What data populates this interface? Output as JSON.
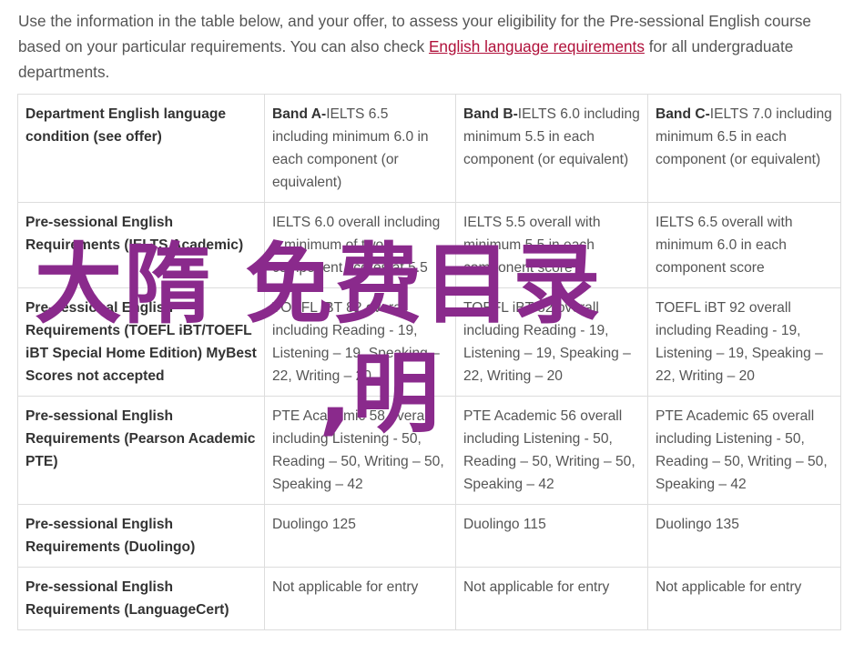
{
  "intro": {
    "text_before_link": "Use the information in the table below, and your offer, to assess your eligibility for the Pre-sessional English course based on your particular requirements. You can also check ",
    "link_text": "English language requirements",
    "text_after_link": " for all undergraduate departments."
  },
  "table": {
    "header": {
      "row_label": "Department English language condition (see offer)",
      "bands": [
        {
          "name": "Band A-",
          "detail": "IELTS 6.5 including minimum 6.0 in each component (or equivalent)"
        },
        {
          "name": "Band B-",
          "detail": "IELTS 6.0 including minimum 5.5 in each component (or equivalent)"
        },
        {
          "name": "Band C-",
          "detail": "IELTS 7.0 including minimum 6.5 in each component (or equivalent)"
        }
      ]
    },
    "rows": [
      {
        "label": "Pre-sessional English Requirements (IELTS Academic)",
        "cells": [
          "IELTS 6.0 overall including a minimum of two component scores at 5.5",
          "IELTS 5.5 overall with minimum 5.5 in each component score",
          "IELTS 6.5 overall with minimum 6.0 in each component score"
        ]
      },
      {
        "label": "Pre-sessional English Requirements (TOEFL iBT/TOEFL iBT Special Home Edition) MyBest Scores not accepted",
        "cells": [
          "TOEFL iBT 82 overall including Reading - 19, Listening – 19, Speaking – 22, Writing – 20",
          "TOEFL iBT 82 overall including Reading - 19, Listening – 19, Speaking – 22, Writing – 20",
          "TOEFL iBT 92 overall including Reading - 19, Listening – 19, Speaking – 22, Writing – 20"
        ]
      },
      {
        "label": "Pre-sessional English Requirements (Pearson Academic PTE)",
        "cells": [
          "PTE Academic 58 overall including Listening - 50, Reading – 50, Writing – 50, Speaking – 42",
          "PTE Academic 56 overall including Listening - 50, Reading – 50, Writing – 50, Speaking – 42",
          "PTE Academic 65 overall including Listening - 50, Reading – 50, Writing – 50, Speaking – 42"
        ]
      },
      {
        "label": "Pre-sessional English Requirements (Duolingo)",
        "cells": [
          "Duolingo 125",
          "Duolingo 115",
          "Duolingo 135"
        ]
      },
      {
        "label": "Pre-sessional English Requirements (LanguageCert)",
        "cells": [
          "Not applicable for entry",
          "Not applicable for entry",
          "Not applicable for entry"
        ]
      }
    ]
  },
  "watermark": {
    "line1": "大隋 免费目录",
    "line2": ",明",
    "color": "#8a2a8c"
  },
  "colors": {
    "link": "#b0103a",
    "border": "#dddddd",
    "text": "#555555"
  }
}
